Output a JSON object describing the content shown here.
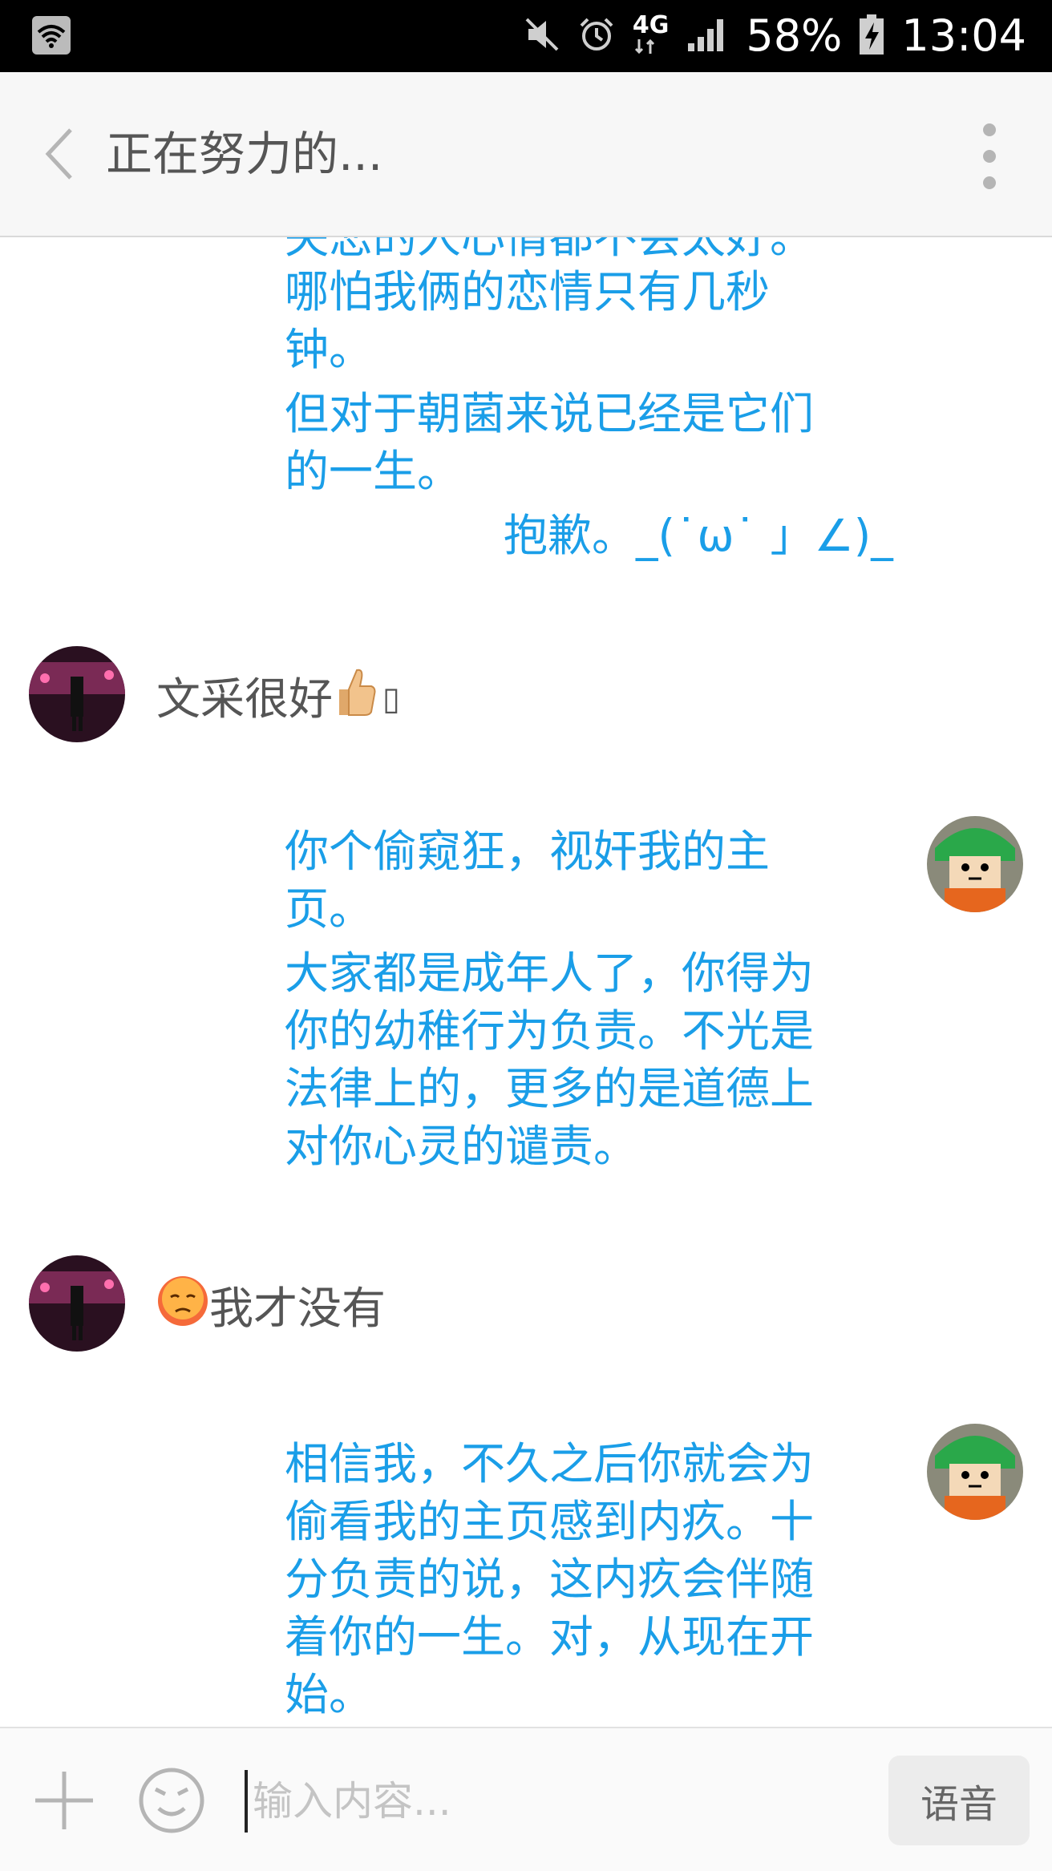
{
  "status_bar": {
    "network": "4G",
    "battery": "58%",
    "time": "13:04",
    "icons": [
      "wifi-icon",
      "mute-icon",
      "alarm-icon",
      "signal-icon",
      "battery-charging-icon"
    ]
  },
  "header": {
    "title": "正在努力的...",
    "back_icon": "chevron-left-icon",
    "more_icon": "more-vertical-icon"
  },
  "messages": [
    {
      "direction": "outgoing",
      "partial_line": "失恋的人心情都不会太好。",
      "paragraphs": [
        "哪怕我俩的恋情只有几秒\n钟。",
        "但对于朝菌来说已经是它们\n的一生。"
      ],
      "kaomoji": "抱歉。_(˙ω˙ 」∠)_"
    },
    {
      "direction": "incoming",
      "text": "文采很好",
      "emoji": "thumbs-up",
      "trailing": "▯"
    },
    {
      "direction": "outgoing",
      "paragraphs": [
        "你个偷窥狂，视奸我的主\n页。",
        "大家都是成年人了，你得为\n你的幼稚行为负责。不光是\n法律上的，更多的是道德上\n对你心灵的谴责。"
      ]
    },
    {
      "direction": "incoming",
      "emoji": "pouting-face",
      "text": "我才没有"
    },
    {
      "direction": "outgoing",
      "paragraphs": [
        "相信我，不久之后你就会为\n偷看我的主页感到内疚。十\n分负责的说，这内疚会伴随\n着你的一生。对，从现在开\n始。"
      ]
    }
  ],
  "input_bar": {
    "placeholder": "输入内容...",
    "value": "",
    "voice_label": "语音",
    "plus_icon": "plus-icon",
    "emoji_icon": "emoji-face-icon"
  },
  "colors": {
    "outgoing_text": "#1a9ee8",
    "incoming_text": "#555555",
    "header_bg": "#f7f7f7",
    "status_bg": "#000000"
  }
}
